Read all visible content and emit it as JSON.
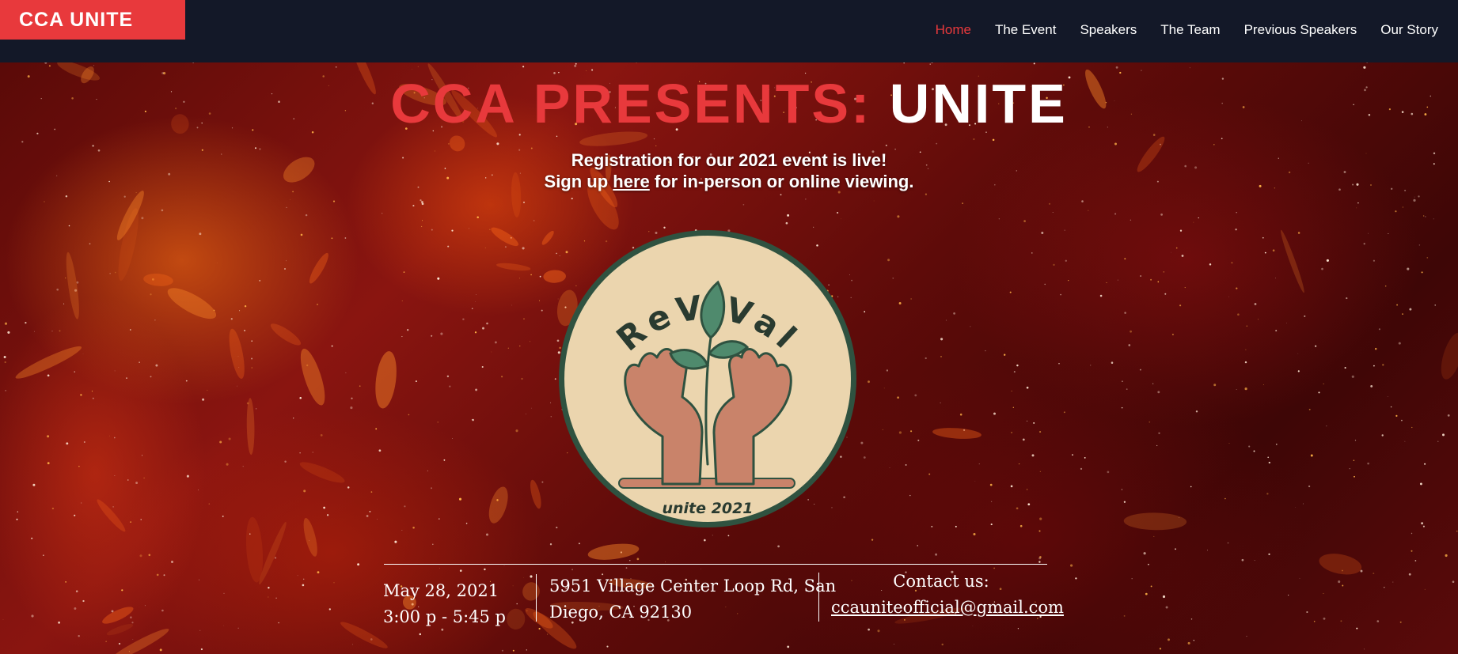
{
  "header": {
    "brand": "CCA UNITE",
    "nav": [
      {
        "label": "Home",
        "active": true
      },
      {
        "label": "The Event"
      },
      {
        "label": "Speakers"
      },
      {
        "label": "The Team"
      },
      {
        "label": "Previous Speakers"
      },
      {
        "label": "Our Story"
      }
    ]
  },
  "hero": {
    "headline_red": "CCA PRESENTS:",
    "headline_white": "UNITE",
    "registration_line1": "Registration for our 2021 event is live!",
    "signup_prefix": "Sign up",
    "signup_link": "here",
    "signup_suffix": "for in-person or online viewing."
  },
  "logo": {
    "title": "ReViVal",
    "subtitle": "unite 2021",
    "icon": "hands-holding-sprout-icon"
  },
  "details": {
    "date": "May 28, 2021",
    "time": "3:00 p - 5:45 p",
    "address_line1": "5951 Village Center Loop Rd, San",
    "address_line2": "Diego, CA 92130",
    "contact_label": "Contact us:",
    "contact_email": "ccauniteofficial@gmail.com"
  },
  "colors": {
    "accent": "#e8393c",
    "header_bg": "#131828",
    "logo_bg": "#ebd5ae",
    "logo_ring": "#2f5240",
    "leaf": "#4f8a6d",
    "hands": "#c9836a"
  }
}
